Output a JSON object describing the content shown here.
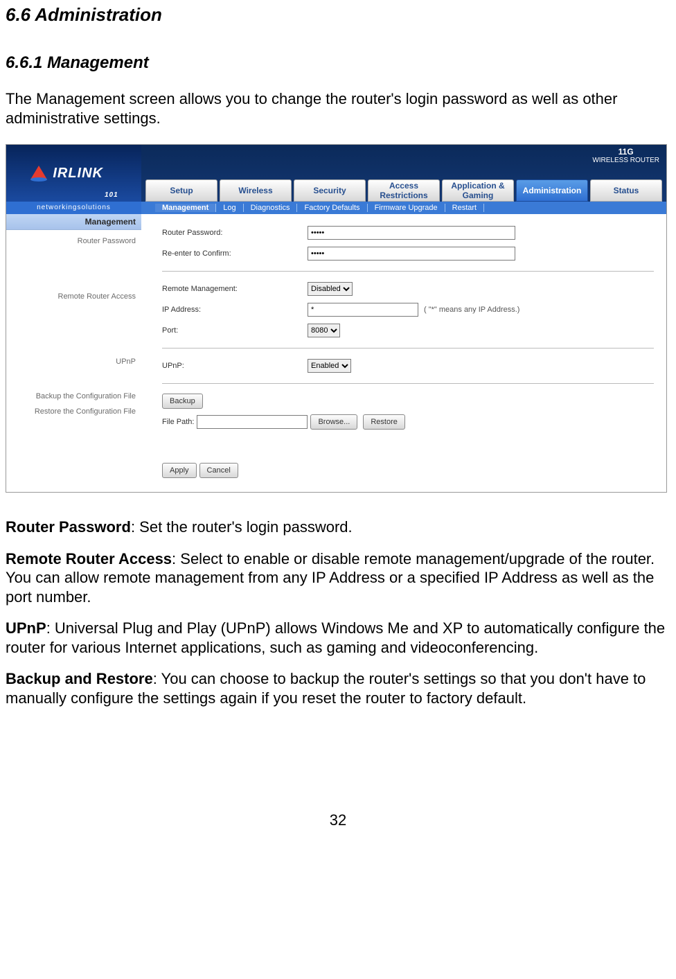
{
  "doc": {
    "h1": "6.6 Administration",
    "h2": "6.6.1 Management",
    "intro": "The Management screen allows you to change the router's login password as well as other administrative settings.",
    "routerPwdLabel": "Router Password",
    "routerPwdText": ": Set the router's login password.",
    "remoteLabel": "Remote Router Access",
    "remoteText": ": Select to enable or disable remote management/upgrade of the router. You can allow remote management from any IP Address or a specified IP Address as well as the port number.",
    "upnpLabel": "UPnP",
    "upnpText": ": Universal Plug and Play (UPnP) allows Windows Me and XP to automatically configure the router for various Internet applications, such as gaming and videoconferencing.",
    "backupLabel": "Backup and Restore",
    "backupText": ": You can choose to backup the router's settings so that you don't have to manually configure the settings again if you reset the router to factory default.",
    "pageNum": "32"
  },
  "ui": {
    "brand": "IRLINK",
    "brandSuffix": "101",
    "tagline": "networkingsolutions",
    "badgeTop": "11G",
    "badgeBottom": "WIRELESS ROUTER",
    "tabs": [
      "Setup",
      "Wireless",
      "Security",
      "Access Restrictions",
      "Application & Gaming",
      "Administration",
      "Status"
    ],
    "subtabs": [
      "Management",
      "Log",
      "Diagnostics",
      "Factory Defaults",
      "Firmware Upgrade",
      "Restart"
    ],
    "left": {
      "title": "Management",
      "s1": "Router Password",
      "s2": "Remote Router Access",
      "s3": "UPnP",
      "s4": "Backup the Configuration File",
      "s5": "Restore the Configuration File"
    },
    "form": {
      "pwdLabel": "Router Password:",
      "pwdValue": "•••••",
      "confirmLabel": "Re-enter to Confirm:",
      "confirmValue": "•••••",
      "remoteMgmtLabel": "Remote Management:",
      "remoteMgmtValue": "Disabled",
      "ipLabel": "IP Address:",
      "ipValue": "*",
      "ipNote": "( \"*\" means any IP Address.)",
      "portLabel": "Port:",
      "portValue": "8080",
      "upnpLabel": "UPnP:",
      "upnpValue": "Enabled",
      "backupBtn": "Backup",
      "filePathLabel": "File Path:",
      "browseBtn": "Browse...",
      "restoreBtn": "Restore",
      "applyBtn": "Apply",
      "cancelBtn": "Cancel"
    }
  }
}
